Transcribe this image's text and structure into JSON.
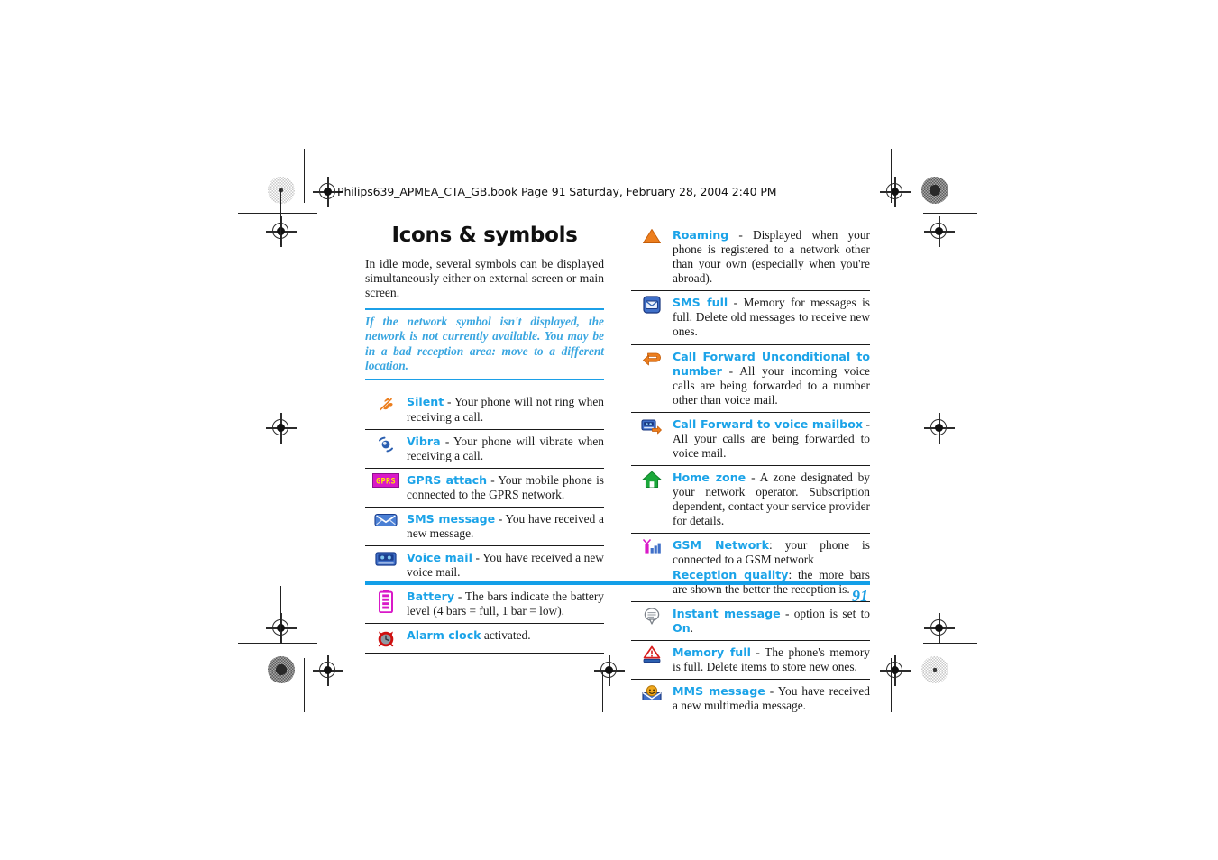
{
  "header": {
    "book_line": "Philips639_APMEA_CTA_GB.book  Page 91  Saturday, February 28, 2004  2:40 PM"
  },
  "page": {
    "title": "Icons & symbols",
    "intro": "In idle mode, several symbols can be displayed simultaneously either on external screen or main screen.",
    "note": "If the network symbol isn't displayed, the network is not currently available. You may be in a bad reception area: move to a different location.",
    "page_number": "91"
  },
  "colors": {
    "accent_blue": "#1ba3e8",
    "rule_blue": "#139fe8",
    "note_blue": "#3aa6e0",
    "orange": "#ec7e1e",
    "magenta": "#d919c8",
    "green": "#1ba83a",
    "red": "#d81e1e",
    "icon_blue": "#2b5fb0"
  },
  "left_column": {
    "rows": [
      {
        "icon": "silent-note-icon",
        "keyword": "Silent",
        "description": " - Your phone will not ring when receiving a call."
      },
      {
        "icon": "vibra-icon",
        "keyword": "Vibra",
        "description": " - Your phone will vibrate when receiving a call."
      },
      {
        "icon": "gprs-attach-icon",
        "keyword": "GPRS attach",
        "description": " - Your mobile phone is connected to the GPRS network."
      },
      {
        "icon": "sms-message-envelope-icon",
        "keyword": "SMS message",
        "description": " - You have received a new message."
      },
      {
        "icon": "voice-mail-icon",
        "keyword": "Voice mail",
        "description": " - You have received a new voice mail."
      },
      {
        "icon": "battery-icon",
        "keyword": "Battery",
        "description": " - The bars indicate the battery level (4 bars = full, 1 bar = low)."
      },
      {
        "icon": "alarm-clock-icon",
        "keyword": "Alarm clock",
        "description": " activated."
      }
    ]
  },
  "right_column": {
    "rows": [
      {
        "icon": "roaming-triangle-icon",
        "keyword": "Roaming",
        "description": " - Displayed when your phone is registered to a network other than your own (especially when you're abroad)."
      },
      {
        "icon": "sms-full-icon",
        "keyword": "SMS full",
        "description": " - Memory for messages is full. Delete old messages to receive new ones."
      },
      {
        "icon": "call-forward-unconditional-icon",
        "keyword": "Call Forward Unconditional to number",
        "description": " - All your incoming voice calls are being forwarded to a number other than voice mail."
      },
      {
        "icon": "call-forward-voice-mailbox-icon",
        "keyword": "Call Forward to voice mailbox",
        "description": " - All your calls are being forwarded to voice mail."
      },
      {
        "icon": "home-zone-house-icon",
        "keyword": "Home zone",
        "description": " - A zone designated by your network operator. Subscription dependent, contact your service provider for details."
      },
      {
        "icon": "gsm-network-signal-icon",
        "keyword": "GSM Network",
        "description": ": your phone is connected to a GSM network",
        "keyword2": "Reception quality",
        "description2": ": the more bars are shown the better the reception is."
      },
      {
        "icon": "instant-message-bubble-icon",
        "keyword": "Instant message",
        "description": " - option is set to ",
        "keyword2": "On",
        "description2": "."
      },
      {
        "icon": "memory-full-icon",
        "keyword": "Memory full",
        "description": " - The phone's memory is full. Delete items to store new ones."
      },
      {
        "icon": "mms-message-icon",
        "keyword": "MMS message",
        "description": " - You have received a new multimedia message."
      }
    ]
  }
}
